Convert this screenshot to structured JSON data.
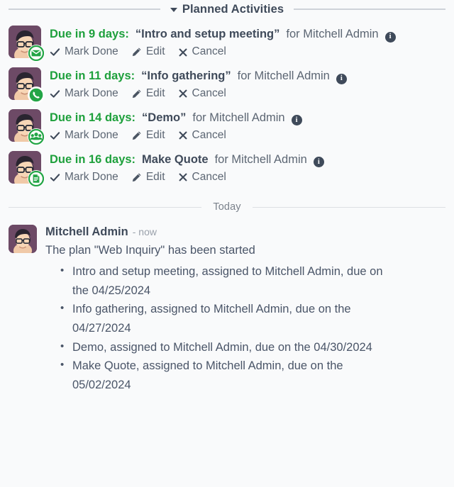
{
  "sections": {
    "planned_activities": {
      "label": "Planned Activities",
      "caret_icon": "chevron-down-icon"
    },
    "today": {
      "label": "Today"
    }
  },
  "colors": {
    "page_background": "#f9fafb",
    "due_green": "#1ea03c",
    "heading": "#3f4a5a",
    "muted_text": "#5c6673",
    "divider": "#ced2d9",
    "badge_green": "#23a546",
    "avatar_background": "#6d4a66"
  },
  "actions": {
    "mark_done": "Mark Done",
    "edit": "Edit",
    "cancel": "Cancel",
    "mark_done_icon": "check-icon",
    "edit_icon": "pencil-icon",
    "cancel_icon": "close-icon",
    "info_icon": "info-icon",
    "info_glyph": "i"
  },
  "activities": [
    {
      "due": "Due in 9 days:",
      "subject": "“Intro and setup meeting”",
      "assignee": "for Mitchell Admin",
      "badge_icon": "email-icon",
      "avatar_icon": "user-avatar"
    },
    {
      "due": "Due in 11 days:",
      "subject": "“Info gathering”",
      "assignee": "for Mitchell Admin",
      "badge_icon": "phone-icon",
      "avatar_icon": "user-avatar"
    },
    {
      "due": "Due in 14 days:",
      "subject": "“Demo”",
      "assignee": "for Mitchell Admin",
      "badge_icon": "users-icon",
      "avatar_icon": "user-avatar"
    },
    {
      "due": "Due in 16 days:",
      "subject": "Make Quote",
      "assignee": "for Mitchell Admin",
      "badge_icon": "document-icon",
      "avatar_icon": "user-avatar"
    }
  ],
  "message": {
    "author": "Mitchell Admin",
    "time": "- now",
    "text": "The plan \"Web Inquiry\" has been started",
    "bullets": [
      "Intro and setup meeting, assigned to Mitchell Admin, due on the 04/25/2024",
      "Info gathering, assigned to Mitchell Admin, due on the 04/27/2024",
      "Demo, assigned to Mitchell Admin, due on the 04/30/2024",
      "Make Quote, assigned to Mitchell Admin, due on the 05/02/2024"
    ]
  }
}
